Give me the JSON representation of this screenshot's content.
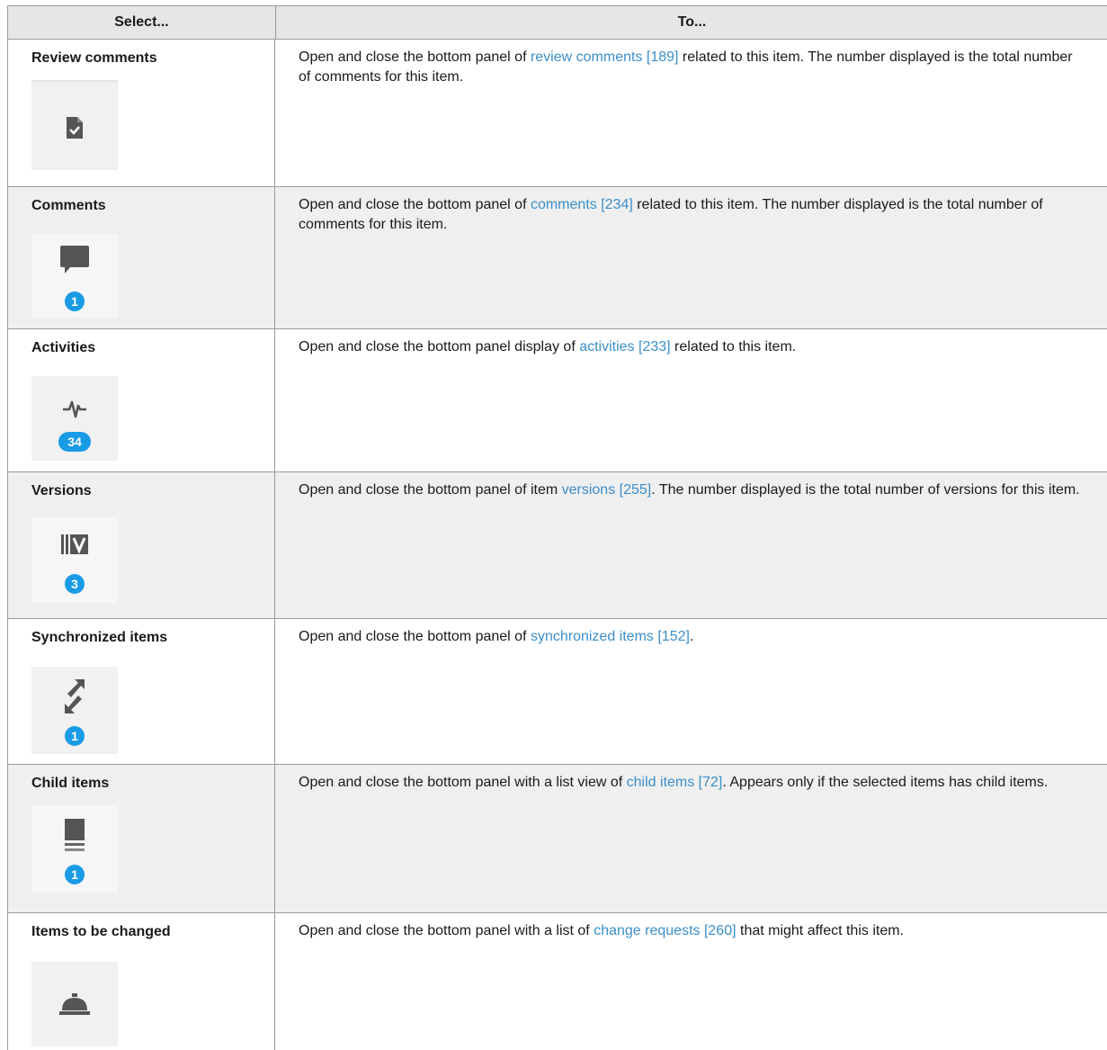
{
  "header": {
    "col1": "Select...",
    "col2": "To..."
  },
  "rows": [
    {
      "label": "Review comments",
      "icon": "review-document-check-icon",
      "badge": "",
      "desc_before": "Open and close the bottom panel of ",
      "link": "review comments [189]",
      "desc_after": " related to this item. The number displayed is the total number of comments for this item."
    },
    {
      "label": "Comments",
      "icon": "speech-bubble-icon",
      "badge": "1",
      "desc_before": "Open and close the bottom panel of ",
      "link": "comments [234]",
      "desc_after": " related to this item. The number displayed is the total number of comments for this item."
    },
    {
      "label": "Activities",
      "icon": "heartbeat-icon",
      "badge": "34",
      "desc_before": "Open and close the bottom panel display of ",
      "link": "activities [233]",
      "desc_after": " related to this item."
    },
    {
      "label": "Versions",
      "icon": "versions-icon",
      "badge": "3",
      "desc_before": "Open and close the bottom panel of item ",
      "link": "versions [255]",
      "desc_after": ". The number displayed is the total number of versions for this item."
    },
    {
      "label": "Synchronized items",
      "icon": "sync-arrows-icon",
      "badge": "1",
      "desc_before": "Open and close the bottom panel of ",
      "link": "synchronized items [152]",
      "desc_after": "."
    },
    {
      "label": "Child items",
      "icon": "stacked-items-icon",
      "badge": "1",
      "desc_before": "Open and close the bottom panel with a list view of ",
      "link": "child items [72]",
      "desc_after": ". Appears only if the selected items has child items."
    },
    {
      "label": "Items to be changed",
      "icon": "service-bell-icon",
      "badge": "",
      "desc_before": "Open and close the bottom panel with a list of ",
      "link": "change requests [260]",
      "desc_after": " that might affect this item."
    }
  ],
  "colors": {
    "link": "#3b8fc9",
    "badge": "#1a9be6",
    "icon": "#555555",
    "alt_row": "#efefef",
    "header_bg": "#e6e6e6"
  }
}
